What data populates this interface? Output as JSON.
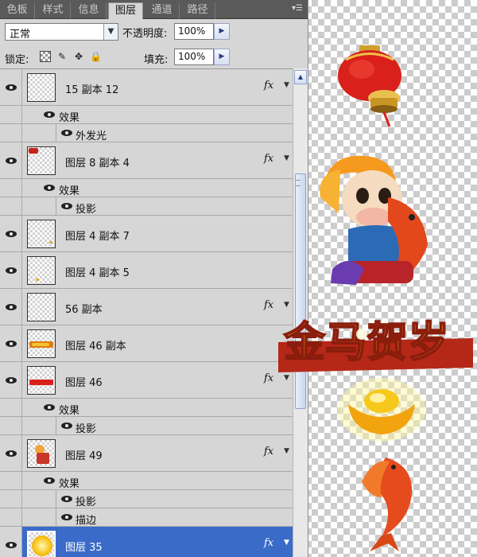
{
  "tabs": [
    "色板",
    "样式",
    "信息",
    "图层",
    "通道",
    "路径"
  ],
  "active_tab": "图层",
  "panel_menu_icon": "panel-menu-icon",
  "blend_mode": "正常",
  "opacity_label": "不透明度:",
  "opacity_value": "100%",
  "lock_label": "锁定:",
  "fill_label": "填充:",
  "fill_value": "100%",
  "layers": [
    {
      "name": "15 副本 12",
      "fx": "fx",
      "effects_label": "效果",
      "effects": [
        "外发光"
      ]
    },
    {
      "name": "图层 8 副本 4",
      "fx": "fx",
      "effects_label": "效果",
      "effects": [
        "投影"
      ]
    },
    {
      "name": "图层 4 副本 7"
    },
    {
      "name": "图层 4 副本 5"
    },
    {
      "name": "56 副本",
      "fx": "fx"
    },
    {
      "name": "图层 46 副本"
    },
    {
      "name": "图层 46",
      "fx": "fx",
      "effects_label": "效果",
      "effects": [
        "投影"
      ]
    },
    {
      "name": "图层 49",
      "fx": "fx",
      "effects_label": "效果",
      "effects": [
        "投影",
        "描边"
      ]
    },
    {
      "name": "图层 35",
      "fx": "fx",
      "selected": true
    }
  ],
  "canvas_banner_text": "金马贺岁",
  "colors": {
    "panel_bg": "#d6d6d6",
    "selected_row": "#3a6bc8",
    "tab_bar": "#5a5a5a"
  }
}
